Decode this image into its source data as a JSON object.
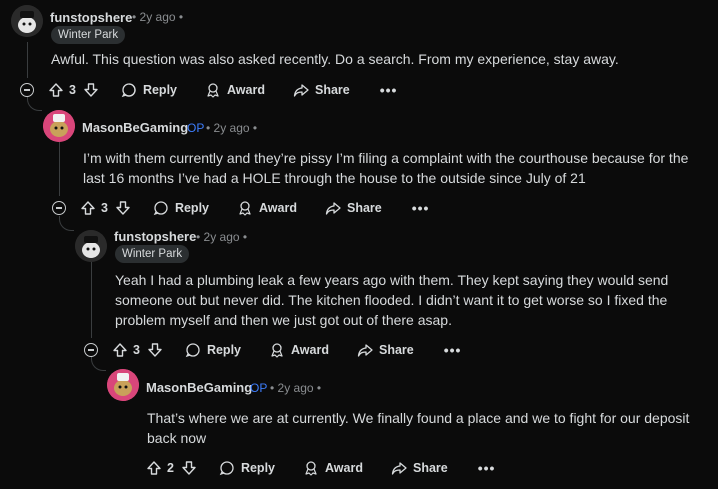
{
  "comments": [
    {
      "author": "funstopshere",
      "op_label": "",
      "time": "2y ago",
      "flair": "Winter Park",
      "body": "Awful. This question was also asked recently. Do a search. From my experience, stay away.",
      "score": "3",
      "avatar": "snoo-dark-avatar"
    },
    {
      "author": "MasonBeGaming",
      "op_label": "OP",
      "time": "2y ago",
      "flair": "",
      "body": "I’m with them currently and they’re pissy I’m filing a complaint with the courthouse because for the last 16 months I’ve had a HOLE through the house to the outside since July of 21",
      "score": "3",
      "avatar": "snoo-pink-avatar"
    },
    {
      "author": "funstopshere",
      "op_label": "",
      "time": "2y ago",
      "flair": "Winter Park",
      "body": "Yeah I had a plumbing leak a few years ago with them. They kept saying they would send someone out but never did. The kitchen flooded. I didn’t want it to get worse so I fixed the problem myself and then we just got out of there asap.",
      "score": "3",
      "avatar": "snoo-dark-avatar"
    },
    {
      "author": "MasonBeGaming",
      "op_label": "OP",
      "time": "2y ago",
      "flair": "",
      "body": "That’s where we are at currently. We finally found a place and we to fight for our deposit back now",
      "score": "2",
      "avatar": "snoo-pink-avatar"
    }
  ],
  "actions": {
    "reply": "Reply",
    "award": "Award",
    "share": "Share",
    "more": "•••"
  },
  "separator": "•",
  "colors": {
    "background": "#0b0b0b",
    "text": "#d7dadc",
    "muted": "#8a8d90",
    "op": "#3d7dfc",
    "flair_bg": "#2b2f31",
    "thread_line": "#3a3d3f"
  }
}
